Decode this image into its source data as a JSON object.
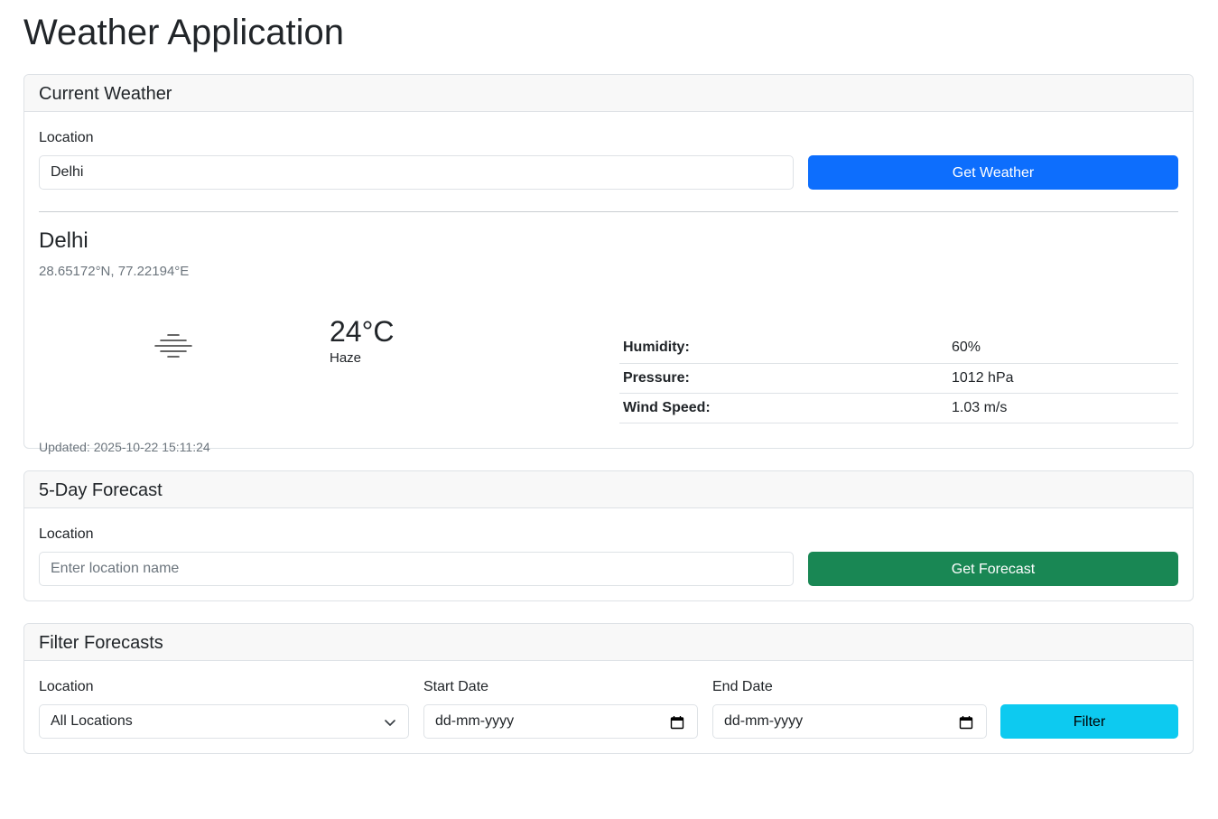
{
  "app": {
    "title": "Weather Application"
  },
  "current": {
    "header": "Current Weather",
    "location_label": "Location",
    "location_value": "Delhi",
    "button_label": "Get Weather",
    "city": "Delhi",
    "coords": "28.65172°N, 77.22194°E",
    "icon": "haze-icon",
    "temperature": "24°C",
    "condition": "Haze",
    "details": [
      {
        "label": "Humidity:",
        "value": "60%"
      },
      {
        "label": "Pressure:",
        "value": "1012 hPa"
      },
      {
        "label": "Wind Speed:",
        "value": "1.03 m/s"
      }
    ],
    "updated": "Updated: 2025-10-22 15:11:24"
  },
  "forecast": {
    "header": "5-Day Forecast",
    "location_label": "Location",
    "placeholder": "Enter location name",
    "button_label": "Get Forecast"
  },
  "filter": {
    "header": "Filter Forecasts",
    "location_label": "Location",
    "location_selected": "All Locations",
    "start_label": "Start Date",
    "start_placeholder": "dd-mm-yyyy",
    "end_label": "End Date",
    "end_placeholder": "dd-mm-yyyy",
    "button_label": "Filter"
  },
  "colors": {
    "primary": "#0d6efd",
    "success": "#198754",
    "info": "#0dcaf0",
    "border": "#dee2e6",
    "muted": "#6c757d"
  }
}
